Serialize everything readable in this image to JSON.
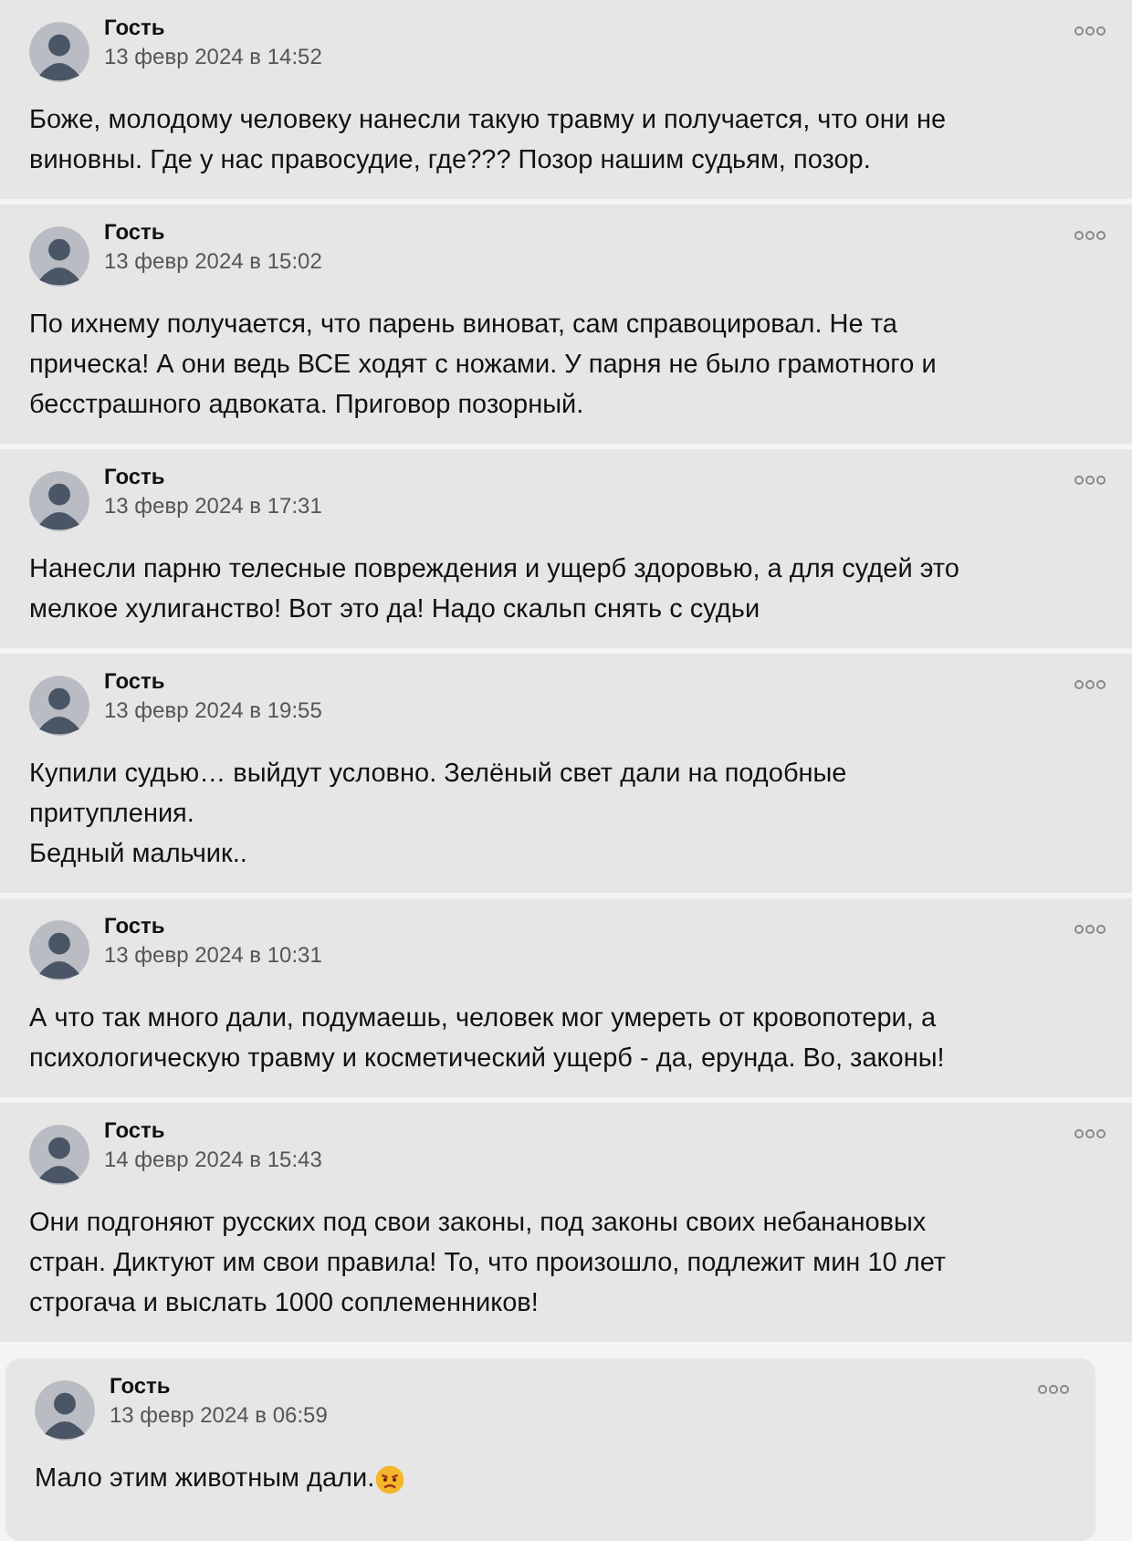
{
  "comments": [
    {
      "author": "Гость",
      "date": "13 февр 2024 в 14:52",
      "text": "Боже, молодому человеку нанесли такую травму и получается, что они не\nвиновны. Где у нас правосудие, где??? Позор нашим судьям, позор."
    },
    {
      "author": "Гость",
      "date": "13 февр 2024 в 15:02",
      "text": "По ихнему получается, что парень виноват, сам справоцировал. Не та\nприческа! А они ведь ВСЕ ходят с ножами. У парня не было грамотного и\nбесстрашного адвоката. Приговор позорный."
    },
    {
      "author": "Гость",
      "date": "13 февр 2024 в 17:31",
      "text": "Нанесли парню телесные повреждения и ущерб здоровью, а для судей это\nмелкое хулиганство! Вот это да! Надо скальп снять с судьи"
    },
    {
      "author": "Гость",
      "date": "13 февр 2024 в 19:55",
      "text": "Купили судью… выйдут условно. Зелёный свет дали на подобные\nпритупления.\nБедный мальчик.."
    },
    {
      "author": "Гость",
      "date": "13 февр 2024 в 10:31",
      "text": "А что так много дали, подумаешь, человек мог умереть от кровопотери, а\nпсихологическую травму и косметический ущерб - да, ерунда. Во, законы!"
    },
    {
      "author": "Гость",
      "date": "14 февр 2024 в 15:43",
      "text": "Они подгоняют русских под свои законы, под законы своих небанановых\nстран. Диктуют им свои правила! То, что произошло, подлежит мин 10 лет\nстрогача и выслать 1000 соплеменников!"
    },
    {
      "author": "Гость",
      "date": "13 февр 2024 в 06:59",
      "text": "Мало этим животным дали.",
      "angry_emoji": true
    }
  ]
}
